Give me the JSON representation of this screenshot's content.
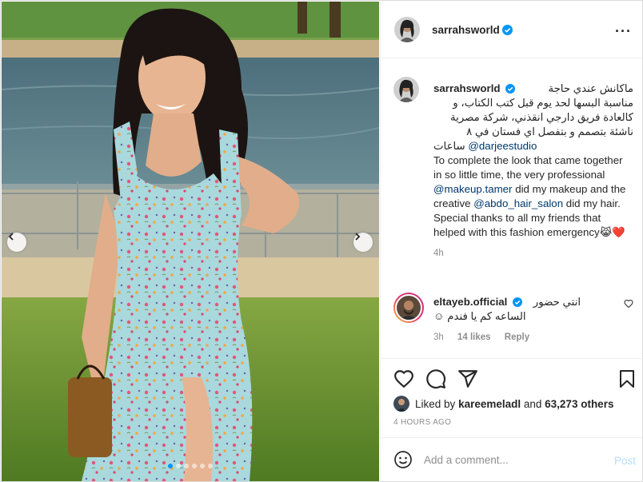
{
  "colors": {
    "accent": "#0095f6",
    "link": "#00376b",
    "muted": "#8e8e8e",
    "like_red": "#ed4956",
    "border": "#efefef"
  },
  "photo": {
    "carousel_dots": 6,
    "active_dot": 1,
    "prev_icon": "chevron-left-icon",
    "next_icon": "chevron-right-icon"
  },
  "header": {
    "username": "sarrahsworld",
    "more_icon": "ellipsis-icon"
  },
  "caption": {
    "username": "sarrahsworld",
    "arabic_line1": "ماكانش عندي حاجة",
    "arabic_line2": "مناسبة البسها لحد يوم قبل كتب الكتاب، و",
    "arabic_line3": "كالعادة فريق دارجي انقذني، شركة مصرية",
    "arabic_line4": "ناشئة بتصمم و بتفصل اي فستان في ٨",
    "arabic_line5": "ساعات",
    "mention_studio": "@darjeestudio",
    "english_1": "To complete the look that came together in so little time, the very professional ",
    "mention_makeup": "@makeup.tamer",
    "english_2": " did my makeup and the creative ",
    "mention_hair": "@abdo_hair_salon",
    "english_3": " did my hair. Special thanks to all my friends that helped with this fashion emergency",
    "emoji": "😹❤️",
    "time": "4h"
  },
  "comment": {
    "username": "eltayeb.official",
    "text_line1": "انتي حضور",
    "text_line2": "الساعه كم يا فندم ☺",
    "time": "3h",
    "likes": "14 likes",
    "reply": "Reply"
  },
  "likes": {
    "prefix": "Liked by ",
    "user": "kareemeladl",
    "middle": " and ",
    "count": "63,273 others"
  },
  "timestamp": "4 HOURS AGO",
  "add_comment": {
    "placeholder": "Add a comment...",
    "post_label": "Post"
  }
}
